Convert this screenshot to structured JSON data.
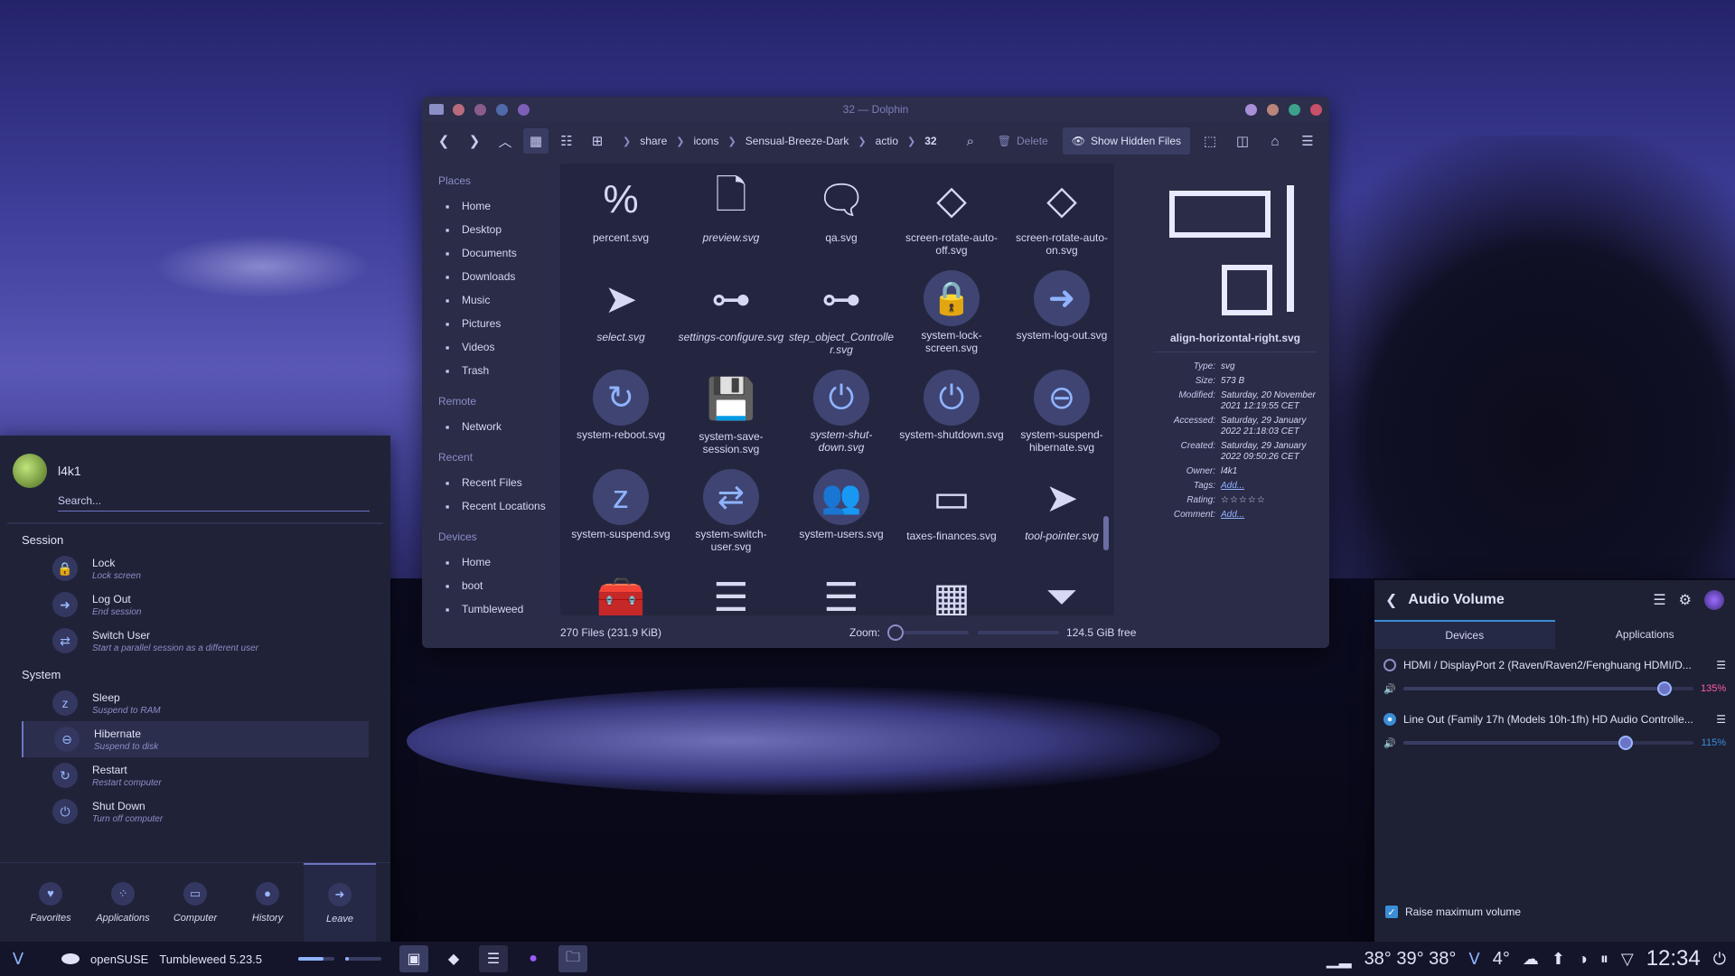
{
  "dolphin": {
    "title": "32 — Dolphin",
    "breadcrumbs": [
      "share",
      "icons",
      "Sensual-Breeze-Dark",
      "actio",
      "32"
    ],
    "toolbar": {
      "delete_label": "Delete",
      "show_hidden_label": "Show Hidden Files"
    },
    "places_header": "Places",
    "places": [
      {
        "label": "Home",
        "icon": "home-icon"
      },
      {
        "label": "Desktop",
        "icon": "desktop-icon"
      },
      {
        "label": "Documents",
        "icon": "documents-icon"
      },
      {
        "label": "Downloads",
        "icon": "downloads-icon"
      },
      {
        "label": "Music",
        "icon": "music-icon"
      },
      {
        "label": "Pictures",
        "icon": "pictures-icon"
      },
      {
        "label": "Videos",
        "icon": "videos-icon"
      },
      {
        "label": "Trash",
        "icon": "trash-icon"
      }
    ],
    "remote_header": "Remote",
    "remote": [
      {
        "label": "Network",
        "icon": "network-icon"
      }
    ],
    "recent_header": "Recent",
    "recent": [
      {
        "label": "Recent Files",
        "icon": "recent-files-icon"
      },
      {
        "label": "Recent Locations",
        "icon": "recent-locations-icon"
      }
    ],
    "devices_header": "Devices",
    "devices": [
      {
        "label": "Home",
        "icon": "drive-icon"
      },
      {
        "label": "boot",
        "icon": "drive-icon"
      },
      {
        "label": "Tumbleweed",
        "icon": "drive-icon"
      }
    ],
    "files": [
      {
        "name": "percent.svg",
        "glyph": "%",
        "style": "plain",
        "italic": false
      },
      {
        "name": "preview.svg",
        "glyph": "🗋",
        "style": "plain",
        "italic": true
      },
      {
        "name": "qa.svg",
        "glyph": "🗨",
        "style": "plain",
        "italic": false
      },
      {
        "name": "screen-rotate-auto-off.svg",
        "glyph": "◇",
        "style": "plain",
        "italic": false
      },
      {
        "name": "screen-rotate-auto-on.svg",
        "glyph": "◇",
        "style": "plain",
        "italic": false
      },
      {
        "name": "select.svg",
        "glyph": "➤",
        "style": "plain",
        "italic": true
      },
      {
        "name": "settings-configure.svg",
        "glyph": "⊶",
        "style": "plain",
        "italic": true
      },
      {
        "name": "step_object_Controller.svg",
        "glyph": "⊶",
        "style": "plain",
        "italic": true
      },
      {
        "name": "system-lock-screen.svg",
        "glyph": "🔒",
        "style": "circle",
        "italic": false
      },
      {
        "name": "system-log-out.svg",
        "glyph": "➜",
        "style": "circle",
        "italic": false
      },
      {
        "name": "system-reboot.svg",
        "glyph": "↻",
        "style": "circle",
        "italic": false
      },
      {
        "name": "system-save-session.svg",
        "glyph": "💾",
        "style": "plain",
        "italic": false
      },
      {
        "name": "system-shut-down.svg",
        "glyph": "⏻",
        "style": "circle",
        "italic": true
      },
      {
        "name": "system-shutdown.svg",
        "glyph": "⏻",
        "style": "circle",
        "italic": false
      },
      {
        "name": "system-suspend-hibernate.svg",
        "glyph": "⊖",
        "style": "circle",
        "italic": false
      },
      {
        "name": "system-suspend.svg",
        "glyph": "z",
        "style": "circle",
        "italic": false
      },
      {
        "name": "system-switch-user.svg",
        "glyph": "⇄",
        "style": "circle",
        "italic": false
      },
      {
        "name": "system-users.svg",
        "glyph": "👥",
        "style": "circle",
        "italic": false
      },
      {
        "name": "taxes-finances.svg",
        "glyph": "▭",
        "style": "plain",
        "italic": false
      },
      {
        "name": "tool-pointer.svg",
        "glyph": "➤",
        "style": "plain",
        "italic": true
      },
      {
        "name": "",
        "glyph": "🧰",
        "style": "plain",
        "italic": false
      },
      {
        "name": "",
        "glyph": "☰",
        "style": "plain",
        "italic": false
      },
      {
        "name": "",
        "glyph": "☰",
        "style": "plain",
        "italic": false
      },
      {
        "name": "",
        "glyph": "▦",
        "style": "plain",
        "italic": false
      },
      {
        "name": "",
        "glyph": "⏷",
        "style": "plain",
        "italic": false
      }
    ],
    "info": {
      "filename": "align-horizontal-right.svg",
      "meta": [
        {
          "k": "Type:",
          "v": "svg"
        },
        {
          "k": "Size:",
          "v": "573 B"
        },
        {
          "k": "Modified:",
          "v": "Saturday, 20 November 2021 12:19:55 CET"
        },
        {
          "k": "Accessed:",
          "v": "Saturday, 29 January 2022 21:18:03 CET"
        },
        {
          "k": "Created:",
          "v": "Saturday, 29 January 2022 09:50:26 CET"
        },
        {
          "k": "Owner:",
          "v": "l4k1"
        },
        {
          "k": "Tags:",
          "v": "Add...",
          "link": true
        },
        {
          "k": "Rating:",
          "v": "☆☆☆☆☆",
          "stars": true
        },
        {
          "k": "Comment:",
          "v": "Add...",
          "link": true
        }
      ]
    },
    "status": {
      "count": "270 Files (231.9 KiB)",
      "zoom_label": "Zoom:",
      "free": "124.5 GiB free"
    }
  },
  "launcher": {
    "username": "l4k1",
    "search_placeholder": "Search...",
    "session_header": "Session",
    "session": [
      {
        "title": "Lock",
        "sub": "Lock screen",
        "icon": "🔒",
        "name": "lock"
      },
      {
        "title": "Log Out",
        "sub": "End session",
        "icon": "➜",
        "name": "log-out"
      },
      {
        "title": "Switch User",
        "sub": "Start a parallel session as a different user",
        "icon": "⇄",
        "name": "switch-user"
      }
    ],
    "system_header": "System",
    "system": [
      {
        "title": "Sleep",
        "sub": "Suspend to RAM",
        "icon": "z",
        "name": "sleep"
      },
      {
        "title": "Hibernate",
        "sub": "Suspend to disk",
        "icon": "⊖",
        "name": "hibernate"
      },
      {
        "title": "Restart",
        "sub": "Restart computer",
        "icon": "↻",
        "name": "restart"
      },
      {
        "title": "Shut Down",
        "sub": "Turn off computer",
        "icon": "⏻",
        "name": "shut-down"
      }
    ],
    "tabs": [
      {
        "label": "Favorites",
        "icon": "♥"
      },
      {
        "label": "Applications",
        "icon": "⁘"
      },
      {
        "label": "Computer",
        "icon": "▭"
      },
      {
        "label": "History",
        "icon": "●"
      },
      {
        "label": "Leave",
        "icon": "➜"
      }
    ]
  },
  "audio": {
    "title": "Audio Volume",
    "tabs": [
      "Devices",
      "Applications"
    ],
    "devices": [
      {
        "name": "HDMI / DisplayPort 2 (Raven/Raven2/Fenghuang HDMI/D...",
        "percent_label": "135%",
        "value": 135,
        "color": "#ff5aa5",
        "active": false
      },
      {
        "name": "Line Out (Family 17h (Models 10h-1fh) HD Audio Controlle...",
        "percent_label": "115%",
        "value": 115,
        "color": "#3a8dd6",
        "active": true
      }
    ],
    "raise_label": "Raise maximum volume"
  },
  "taskbar": {
    "os_name": "openSUSE",
    "os_version": "Tumbleweed 5.23.5",
    "temps": "38° 39° 38°",
    "weather": "4°",
    "clock": "12:34"
  }
}
